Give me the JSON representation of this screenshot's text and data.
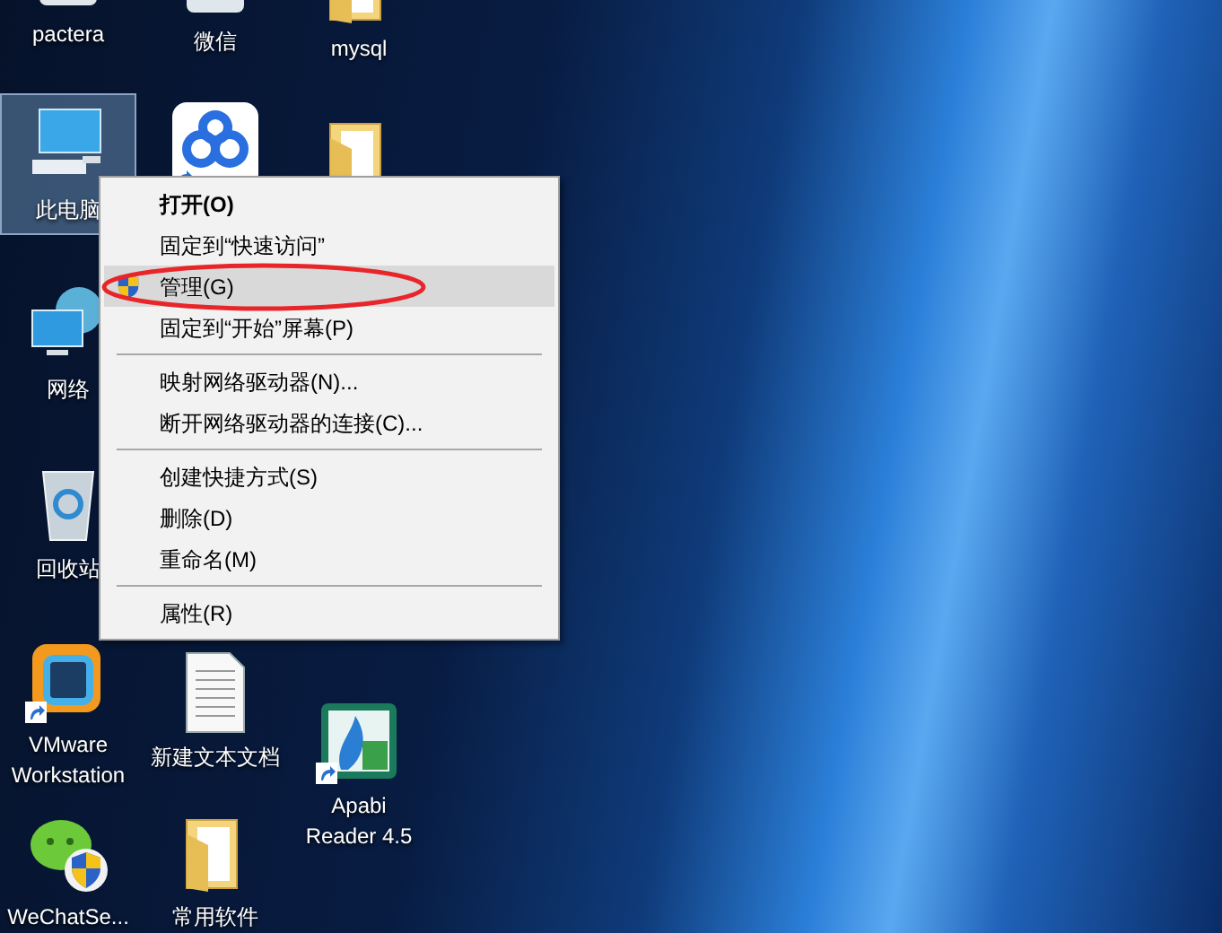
{
  "desktop_icons": [
    {
      "kind": "generic",
      "label": "pactera",
      "selected": false,
      "shortcut": false
    },
    {
      "kind": "generic",
      "label": "微信",
      "selected": false,
      "shortcut": false
    },
    {
      "kind": "folder",
      "label": "mysql",
      "selected": false,
      "shortcut": false
    },
    {
      "kind": "computer",
      "label": "此电脑",
      "selected": true,
      "shortcut": false
    },
    {
      "kind": "cloud-app",
      "selected": false,
      "shortcut": true
    },
    {
      "kind": "folder",
      "selected": false,
      "shortcut": false
    },
    {
      "kind": "network",
      "label": "网络",
      "selected": false,
      "shortcut": false
    },
    {
      "kind": "recycle-bin",
      "label": "回收站",
      "selected": false,
      "shortcut": false
    },
    {
      "kind": "vmware",
      "label": "VMware Workstation",
      "selected": false,
      "shortcut": true
    },
    {
      "kind": "text-document",
      "label": "新建文本文档",
      "selected": false,
      "shortcut": false
    },
    {
      "kind": "apabi",
      "label": "Apabi Reader 4.5",
      "selected": false,
      "shortcut": true
    },
    {
      "kind": "wechat-setup",
      "label": "WeChatSe...",
      "selected": false,
      "shortcut": false
    },
    {
      "kind": "folder",
      "label": "常用软件",
      "selected": false,
      "shortcut": false
    }
  ],
  "context_menu": [
    {
      "kind": "item",
      "label": "打开(O)",
      "bold": true,
      "selected": false,
      "uac_shield": false
    },
    {
      "kind": "item",
      "label": "固定到“快速访问”",
      "bold": false,
      "selected": false,
      "uac_shield": false
    },
    {
      "kind": "item",
      "label": "管理(G)",
      "bold": false,
      "selected": true,
      "uac_shield": true
    },
    {
      "kind": "item",
      "label": "固定到“开始”屏幕(P)",
      "bold": false,
      "selected": false,
      "uac_shield": false
    },
    {
      "kind": "separator"
    },
    {
      "kind": "item",
      "label": "映射网络驱动器(N)...",
      "bold": false,
      "selected": false,
      "uac_shield": false
    },
    {
      "kind": "item",
      "label": "断开网络驱动器的连接(C)...",
      "bold": false,
      "selected": false,
      "uac_shield": false
    },
    {
      "kind": "separator"
    },
    {
      "kind": "item",
      "label": "创建快捷方式(S)",
      "bold": false,
      "selected": false,
      "uac_shield": false
    },
    {
      "kind": "item",
      "label": "删除(D)",
      "bold": false,
      "selected": false,
      "uac_shield": false
    },
    {
      "kind": "item",
      "label": "重命名(M)",
      "bold": false,
      "selected": false,
      "uac_shield": false
    },
    {
      "kind": "separator"
    },
    {
      "kind": "item",
      "label": "属性(R)",
      "bold": false,
      "selected": false,
      "uac_shield": false
    }
  ]
}
